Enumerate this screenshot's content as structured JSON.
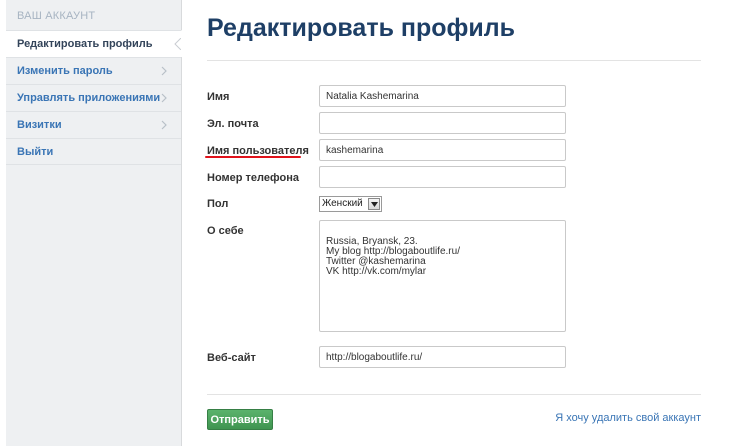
{
  "sidebar": {
    "header": "ВАШ АККАУНТ",
    "items": [
      {
        "label": "Редактировать профиль",
        "active": true
      },
      {
        "label": "Изменить пароль",
        "active": false
      },
      {
        "label": "Управлять приложениями",
        "active": false
      },
      {
        "label": "Визитки",
        "active": false
      },
      {
        "label": "Выйти",
        "active": false
      }
    ]
  },
  "main": {
    "title": "Редактировать профиль",
    "form": {
      "name_label": "Имя",
      "name_value": "Natalia Kashemarina",
      "email_label": "Эл. почта",
      "email_value": "",
      "username_label": "Имя пользователя",
      "username_value": "kashemarina",
      "phone_label": "Номер телефона",
      "phone_value": "",
      "gender_label": "Пол",
      "gender_value": "Женский",
      "about_label": "О себе",
      "about_value": "Russia, Bryansk, 23.\nMy blog http://blogaboutlife.ru/\nTwitter @kashemarina\nVK http://vk.com/mylar",
      "website_label": "Веб-сайт",
      "website_value": "http://blogaboutlife.ru/"
    },
    "submit_label": "Отправить",
    "delete_link": "Я хочу удалить свой аккаунт"
  },
  "colors": {
    "title": "#1e3f66",
    "link": "#3a75b5",
    "submit": "#4ea35f",
    "annotation": "#e0121b"
  }
}
